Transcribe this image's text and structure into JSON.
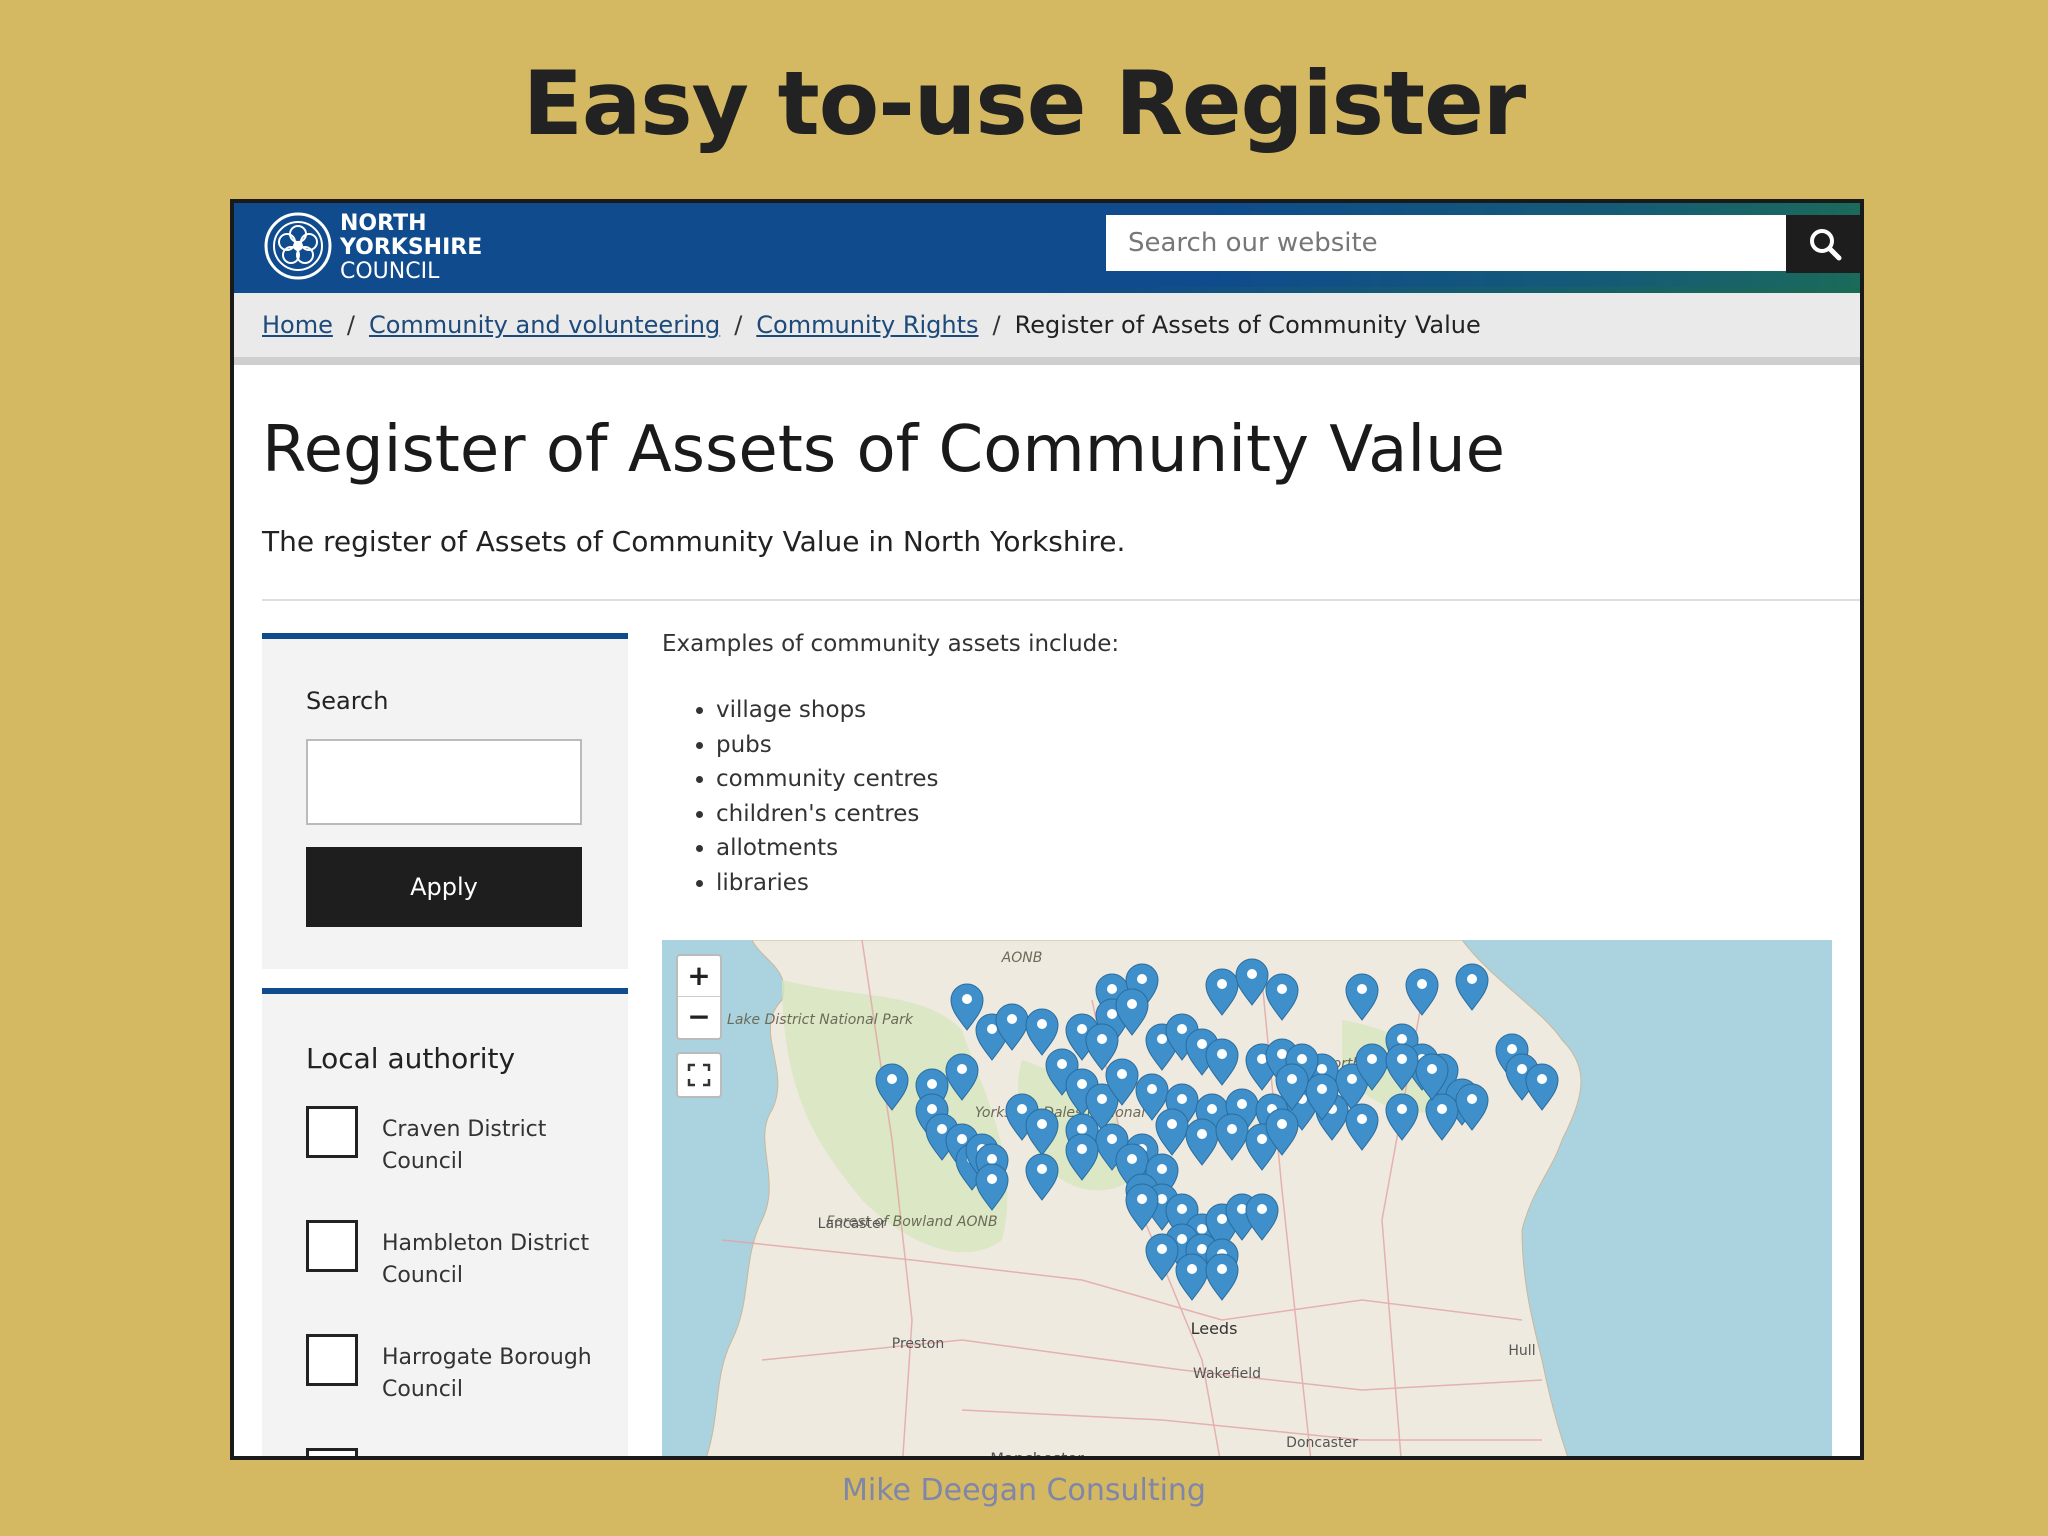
{
  "slide": {
    "title": "Easy to-use Register",
    "footer": "Mike Deegan Consulting"
  },
  "header": {
    "logo_line1": "NORTH",
    "logo_line2": "YORKSHIRE",
    "logo_line3": "COUNCIL",
    "search_placeholder": "Search our website"
  },
  "breadcrumb": {
    "items": [
      "Home",
      "Community and volunteering",
      "Community Rights"
    ],
    "current": "Register of Assets of Community Value"
  },
  "page": {
    "title": "Register of Assets of Community Value",
    "lede": "The register of Assets of Community Value in North Yorkshire."
  },
  "filters": {
    "search_label": "Search",
    "apply_label": "Apply",
    "local_authority_title": "Local authority",
    "authorities": [
      "Craven District Council",
      "Hambleton District Council",
      "Harrogate Borough Council"
    ]
  },
  "content": {
    "intro": "Examples of community assets include:",
    "examples": [
      "village shops",
      "pubs",
      "community centres",
      "children's centres",
      "allotments",
      "libraries"
    ]
  },
  "map": {
    "zoom_in": "+",
    "zoom_out": "−",
    "place_labels": [
      "AONB",
      "Lake District National Park",
      "Yorkshire Dales National",
      "Lancaster",
      "Forest of Bowland AONB",
      "Preston",
      "Leeds",
      "Wakefield",
      "Hull",
      "Doncaster",
      "Manchester",
      "North York Moors"
    ],
    "marker_color": "#3f8fcb"
  },
  "colors": {
    "slide_bg": "#D4B962",
    "header_blue": "#0f4b8d",
    "button_dark": "#1e1e1e"
  }
}
